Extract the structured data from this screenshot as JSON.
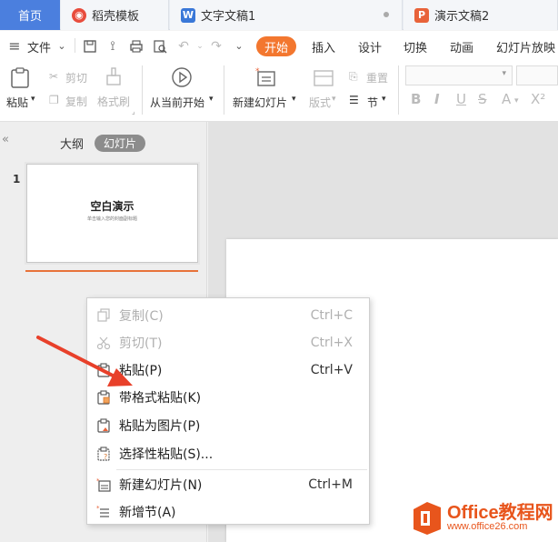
{
  "tabs": {
    "home": "首页",
    "templates": "稻壳模板",
    "writer": "文字文稿1",
    "presentation": "演示文稿2"
  },
  "menu": {
    "file": "文件",
    "start": "开始",
    "insert": "插入",
    "design": "设计",
    "transition": "切换",
    "animation": "动画",
    "slideshow": "幻灯片放映"
  },
  "ribbon": {
    "paste": "粘贴",
    "cut": "剪切",
    "copy": "复制",
    "format_painter": "格式刷",
    "from_current": "从当前开始",
    "new_slide": "新建幻灯片",
    "layout": "版式",
    "reset": "重置",
    "section": "节"
  },
  "left_panel": {
    "outline": "大纲",
    "slides": "幻灯片",
    "slide_number": "1",
    "thumb_title": "空白演示",
    "thumb_subtitle": "单击输入您的封面副标题"
  },
  "context_menu": {
    "copy": {
      "label": "复制(C)",
      "shortcut": "Ctrl+C"
    },
    "cut": {
      "label": "剪切(T)",
      "shortcut": "Ctrl+X"
    },
    "paste": {
      "label": "粘贴(P)",
      "shortcut": "Ctrl+V"
    },
    "paste_keep_format": {
      "label": "带格式粘贴(K)"
    },
    "paste_as_picture": {
      "label": "粘贴为图片(P)"
    },
    "paste_special": {
      "label": "选择性粘贴(S)..."
    },
    "new_slide": {
      "label": "新建幻灯片(N)",
      "shortcut": "Ctrl+M"
    },
    "new_section": {
      "label": "新增节(A)"
    }
  },
  "watermark": {
    "title": "Office教程网",
    "url": "www.office26.com"
  },
  "colors": {
    "accent_orange": "#f3772f",
    "tab_blue": "#4b7fde",
    "arrow_red": "#e8402a",
    "watermark_orange": "#e8551c"
  }
}
